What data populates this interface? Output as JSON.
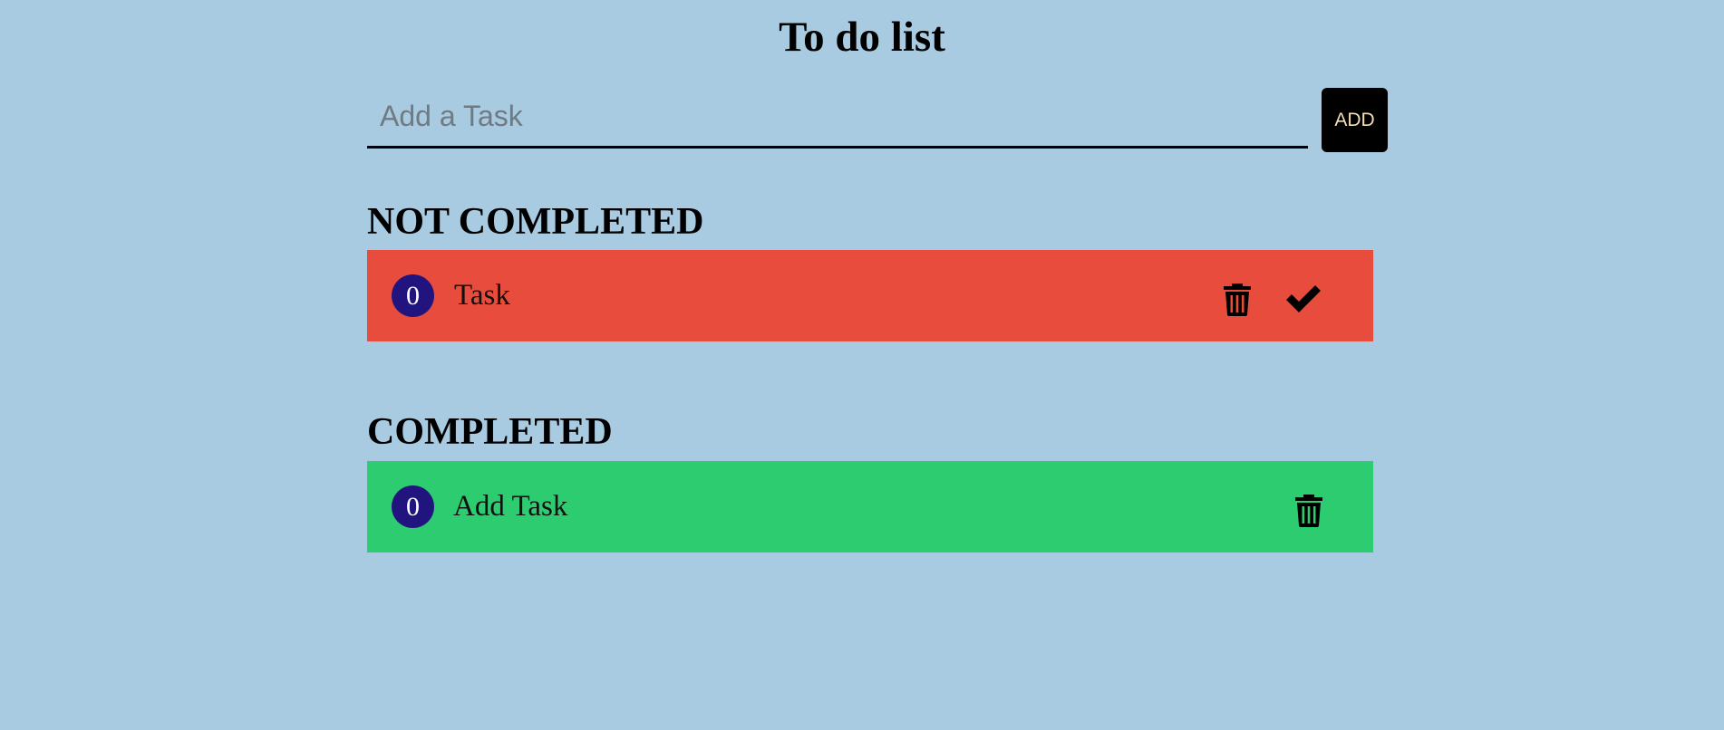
{
  "header": {
    "title": "To do list"
  },
  "add_task": {
    "placeholder": "Add a Task",
    "value": "",
    "button_label": "ADD"
  },
  "not_completed": {
    "heading": "NOT COMPLETED",
    "items": [
      {
        "index": "0",
        "text": "Task"
      }
    ]
  },
  "completed": {
    "heading": "COMPLETED",
    "items": [
      {
        "index": "0",
        "text": "Add Task"
      }
    ]
  },
  "colors": {
    "background": "#a8cbe1",
    "not_completed_card": "#e74c3c",
    "completed_card": "#2ecc71",
    "index_badge": "#22147e",
    "add_button": "#000000",
    "add_button_text": "#f3dfb5"
  },
  "icons": {
    "delete": "trash-icon",
    "complete": "check-icon"
  }
}
